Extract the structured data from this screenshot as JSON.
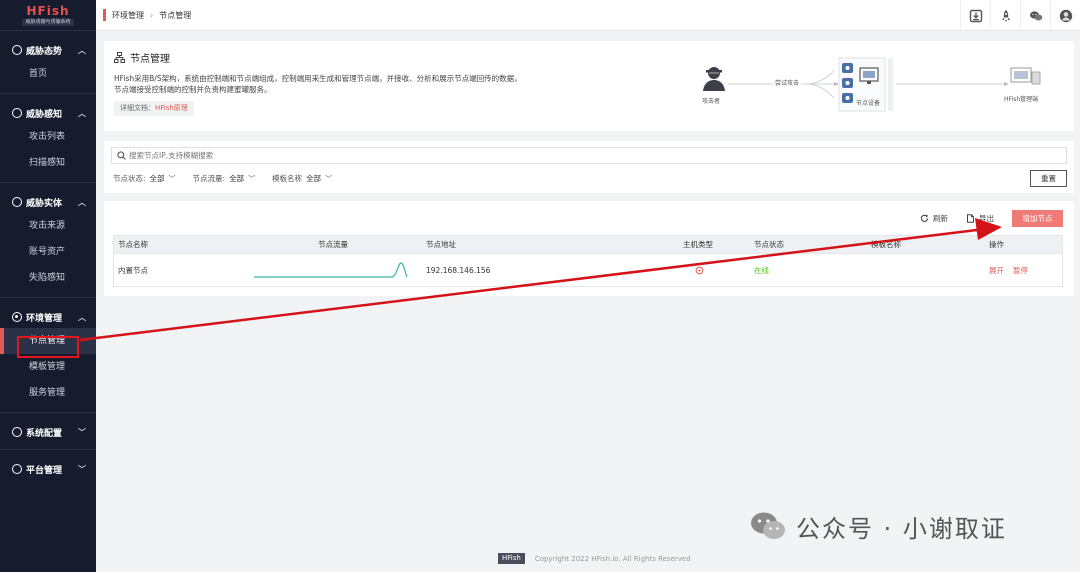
{
  "logo": {
    "title": "HFish",
    "subtitle": "威胁诱捕与诱骗系统"
  },
  "sidebar": {
    "groups": [
      {
        "label": "威胁态势",
        "items": [
          "首页"
        ]
      },
      {
        "label": "威胁感知",
        "items": [
          "攻击列表",
          "扫描感知"
        ]
      },
      {
        "label": "威胁实体",
        "items": [
          "攻击来源",
          "账号资产",
          "失陷感知"
        ]
      },
      {
        "label": "环境管理",
        "items": [
          "节点管理",
          "模板管理",
          "服务管理"
        ]
      },
      {
        "label": "系统配置",
        "items": []
      },
      {
        "label": "平台管理",
        "items": []
      }
    ]
  },
  "breadcrumb": {
    "parent": "环境管理",
    "sep": "›",
    "current": "节点管理"
  },
  "header": {
    "title": "节点管理",
    "desc_line1": "HFish采用B/S架构，系统由控制端和节点端组成，控制端用来生成和管理节点端，并接收、分析和展示节点端回传的数据，",
    "desc_line2": "节点端接受控制端的控制并负责构建蜜罐服务。",
    "doc_prefix": "详细文档：",
    "doc_link": "HFish原理"
  },
  "diagram": {
    "attacker": "攻击者",
    "attempt": "尝试攻击",
    "node": "节点设备",
    "manager": "HFish管理端"
  },
  "search": {
    "placeholder": "搜索节点IP,支持模糊搜索",
    "filters": [
      {
        "label": "节点状态:",
        "value": "全部"
      },
      {
        "label": "节点流量:",
        "value": "全部"
      },
      {
        "label": "模板名称",
        "value": "全部"
      }
    ],
    "reset": "重置"
  },
  "toolbar": {
    "refresh": "刷新",
    "export": "导出",
    "add": "增加节点"
  },
  "table": {
    "headers": [
      "节点名称",
      "节点流量",
      "节点地址",
      "主机类型",
      "节点状态",
      "模板名称",
      "操作"
    ],
    "rows": [
      {
        "name": "内置节点",
        "address": "192.168.146.156",
        "status": "在线",
        "op_expand": "展开",
        "op_pause": "暂停"
      }
    ]
  },
  "footer": {
    "logo": "HFish",
    "copyright": "Copyright 2022 HFish.io. All Rights Reserved"
  },
  "watermark": {
    "text": "公众号 · 小谢取证"
  },
  "colors": {
    "accent": "#e25b56",
    "sidebar_bg": "#161b2e",
    "online": "#52c41a",
    "annotation": "#e3161b"
  }
}
